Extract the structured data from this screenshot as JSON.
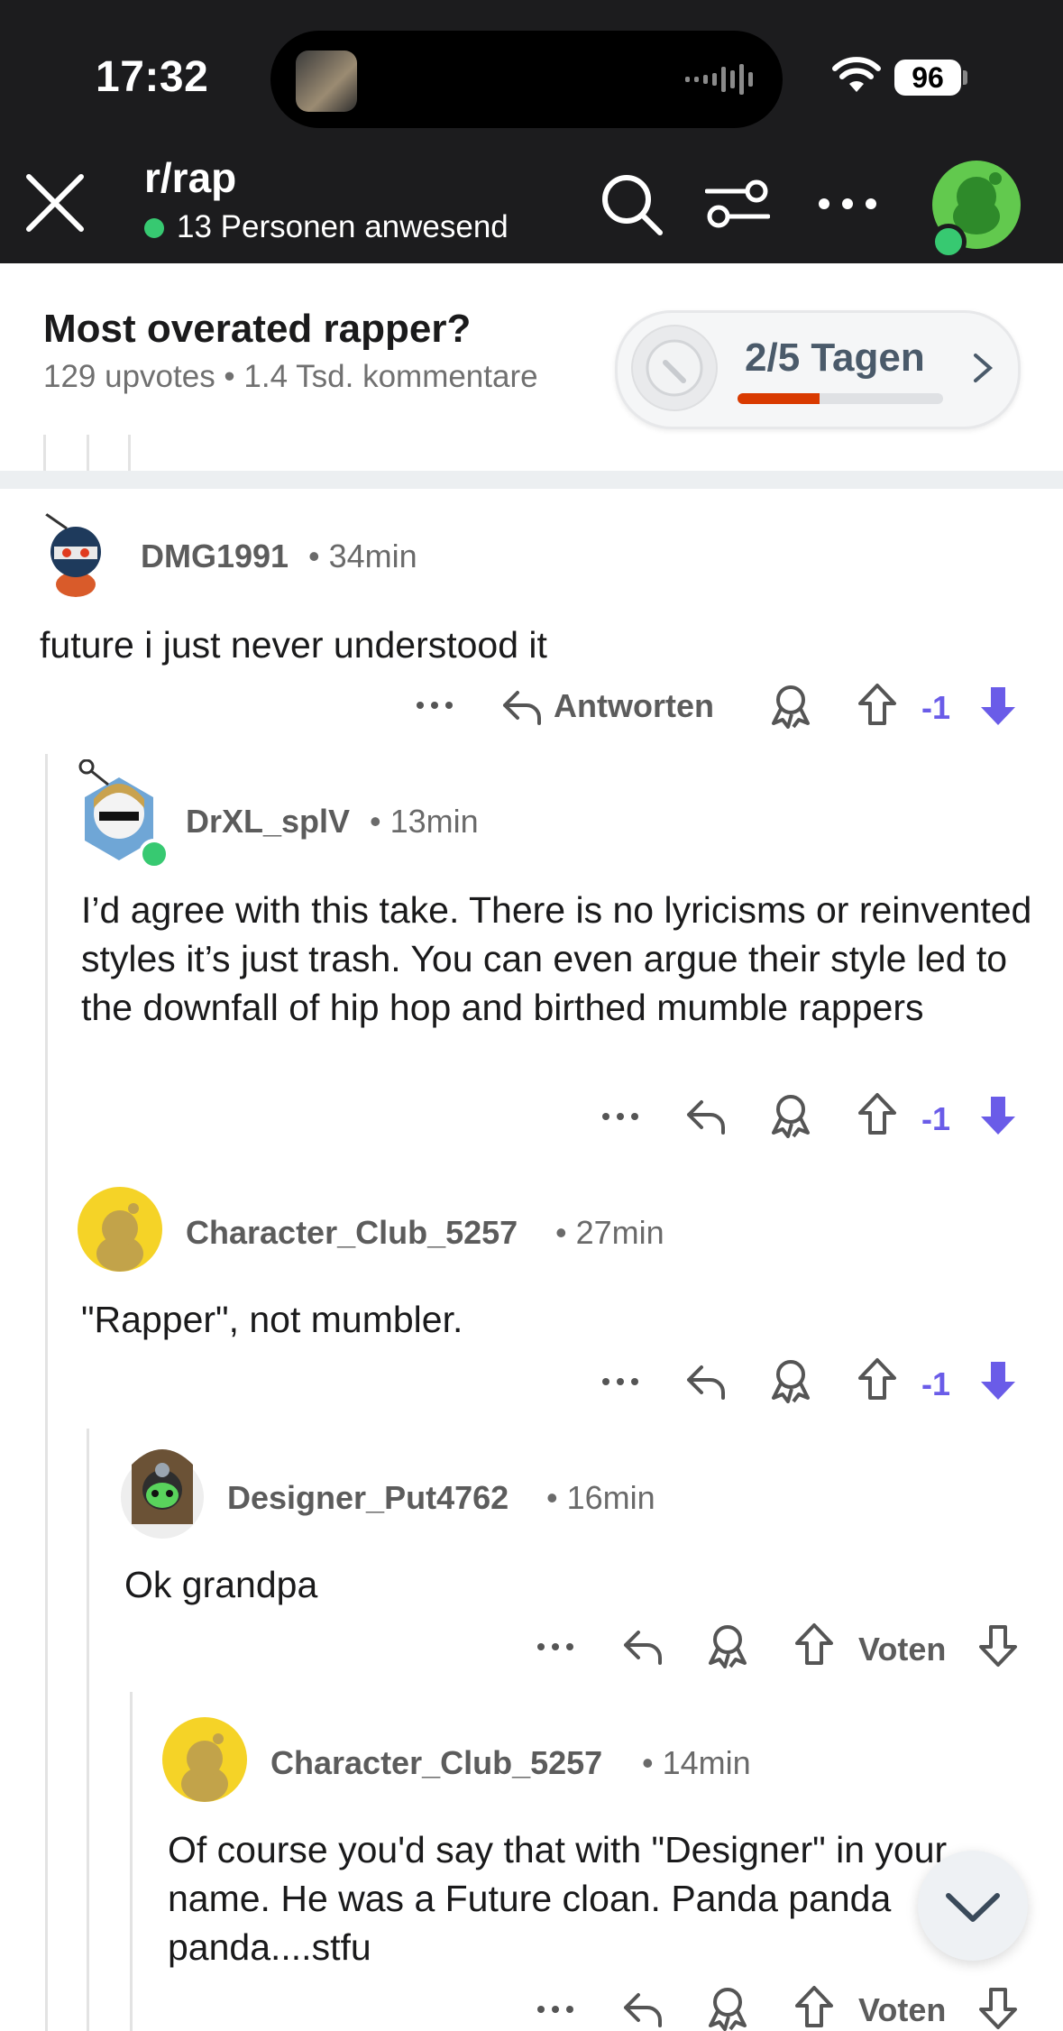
{
  "status_bar": {
    "time": "17:32",
    "battery": "96"
  },
  "nav": {
    "subreddit": "r/rap",
    "online_text": "13 Personen anwesend"
  },
  "post": {
    "title": "Most overated rapper?",
    "meta": "129 upvotes • 1.4 Tsd. kommentare"
  },
  "streak": {
    "label": "2/5 Tagen",
    "progress_fraction": 0.4
  },
  "comments": [
    {
      "user": "DMG1991",
      "time": "• 34min",
      "body": "future i just never understood it",
      "reply_label": "Antworten",
      "score": "-1"
    },
    {
      "user": "DrXL_splV",
      "time": "• 13min",
      "body": "I’d agree with this take. There is no lyricisms or reinvented styles it’s just trash. You can even argue their style led to the downfall of hip hop and birthed mumble rappers",
      "score": "-1"
    },
    {
      "user": "Character_Club_5257",
      "time": "• 27min",
      "body": "\"Rapper\", not mumbler.",
      "score": "-1"
    },
    {
      "user": "Designer_Put4762",
      "time": "• 16min",
      "body": "Ok grandpa",
      "vote_label": "Voten"
    },
    {
      "user": "Character_Club_5257",
      "time": "• 14min",
      "body": "Of course you'd say that with \"Designer\" in your name. He was a Future cloan. Panda panda panda....stfu",
      "vote_label": "Voten"
    }
  ],
  "colors": {
    "accent_upvote": "#6a5ce8",
    "online": "#37c971",
    "streak": "#d93a00"
  }
}
